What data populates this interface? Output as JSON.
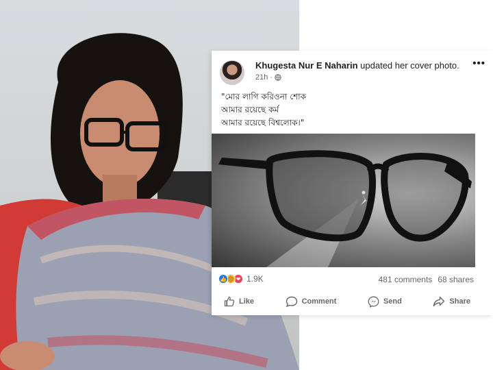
{
  "post": {
    "author": "Khugesta Nur E Naharin",
    "action": "updated her cover photo.",
    "time": "21h ·",
    "more": "•••",
    "text_lines": [
      "\"মোর লাগি করিওনা শোক",
      "আমার রয়েছে কর্ম",
      "আমার রয়েছে বিশ্বলোক।\""
    ]
  },
  "engagement": {
    "reaction_count": "1.9K",
    "comments": "481 comments",
    "shares": "68 shares"
  },
  "actions": {
    "like": "Like",
    "comment": "Comment",
    "send": "Send",
    "share": "Share"
  },
  "colors": {
    "like_blue": "#1877f2",
    "sad_yellow": "#f7b125",
    "love_red": "#f33e58",
    "muted_text": "#65676b"
  }
}
